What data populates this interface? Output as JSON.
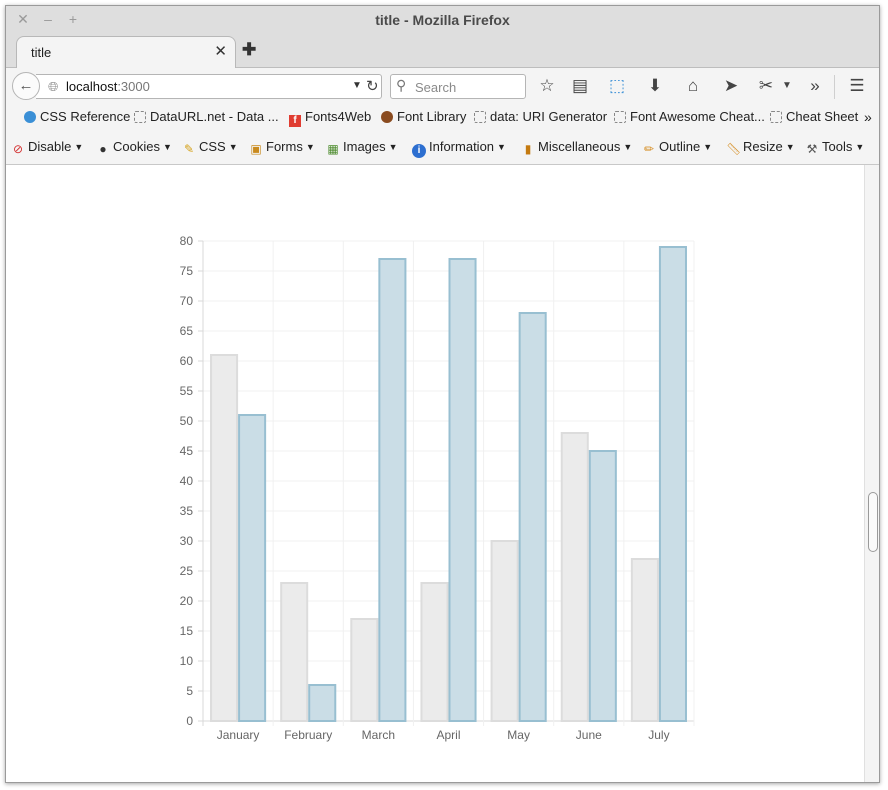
{
  "window": {
    "title": "title - Mozilla Firefox"
  },
  "tab": {
    "title": "title"
  },
  "url": {
    "host": "localhost",
    "port": ":3000"
  },
  "search": {
    "placeholder": "Search"
  },
  "bookmarks": [
    "CSS Reference",
    "DataURL.net - Data ...",
    "Fonts4Web",
    "Font Library",
    "data: URI Generator",
    "Font Awesome Cheat...",
    "Cheat Sheet"
  ],
  "devtoolbar": [
    "Disable",
    "Cookies",
    "CSS",
    "Forms",
    "Images",
    "Information",
    "Miscellaneous",
    "Outline",
    "Resize",
    "Tools"
  ],
  "colors": {
    "series1_fill": "#ebebeb",
    "series1_stroke": "#dcdcdc",
    "series2_fill": "#cadde6",
    "series2_stroke": "#98bfd1"
  },
  "chart_data": {
    "type": "bar",
    "categories": [
      "January",
      "February",
      "March",
      "April",
      "May",
      "June",
      "July"
    ],
    "series": [
      {
        "values": [
          61,
          23,
          17,
          23,
          30,
          48,
          27
        ]
      },
      {
        "values": [
          51,
          6,
          77,
          77,
          68,
          45,
          79
        ]
      }
    ],
    "ylim": [
      0,
      80
    ],
    "yticks": [
      0,
      5,
      10,
      15,
      20,
      25,
      30,
      35,
      40,
      45,
      50,
      55,
      60,
      65,
      70,
      75,
      80
    ],
    "grid": true,
    "legend": "none"
  }
}
